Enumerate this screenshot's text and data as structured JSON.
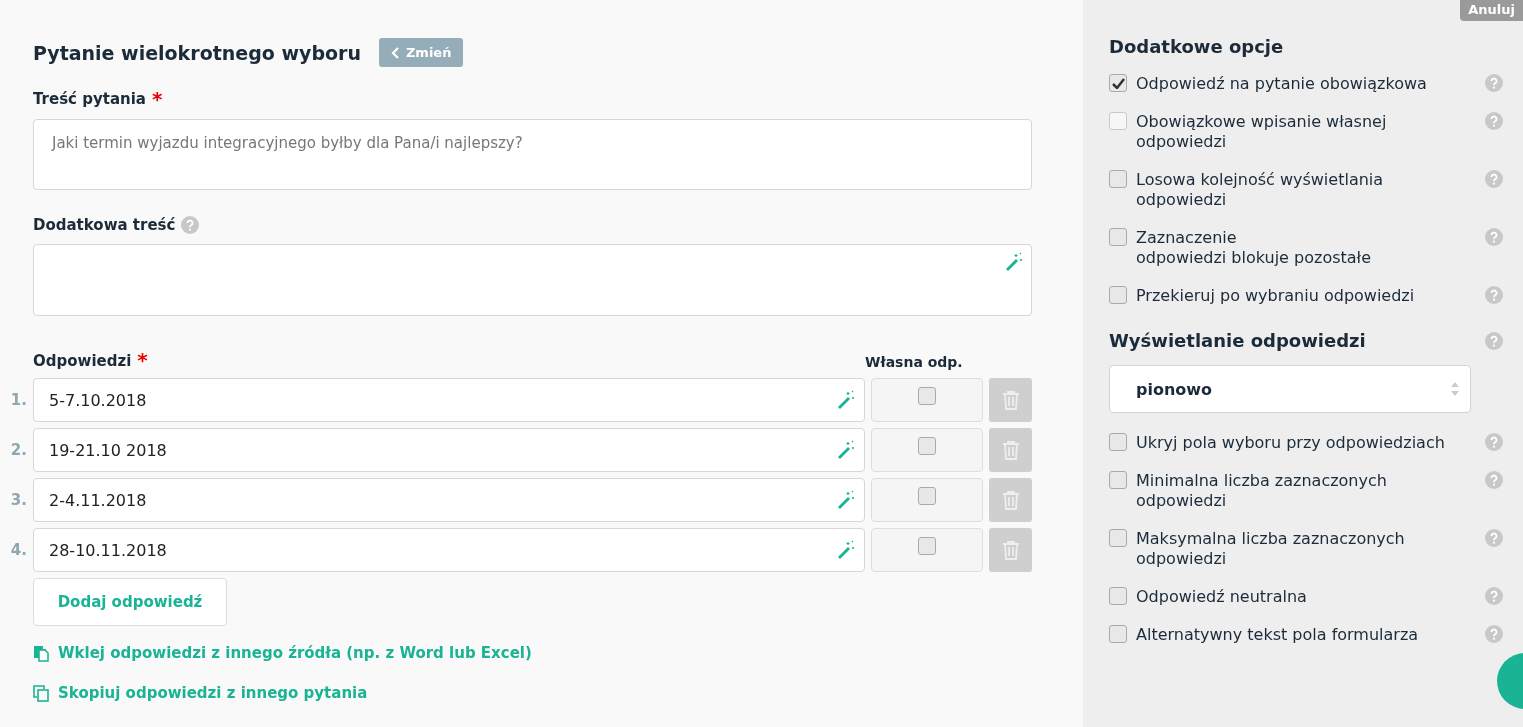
{
  "header": {
    "title": "Pytanie wielokrotnego wyboru",
    "change_button": "Zmień"
  },
  "question": {
    "label": "Treść pytania",
    "required_mark": "*",
    "placeholder": "Jaki termin wyjazdu integracyjnego byłby dla Pana/i najlepszy?"
  },
  "extra": {
    "label": "Dodatkowa treść"
  },
  "answers": {
    "label": "Odpowiedzi",
    "required_mark": "*",
    "own_label": "Własna odp.",
    "items": [
      {
        "number": "1.",
        "value": "5-7.10.2018",
        "own": false
      },
      {
        "number": "2.",
        "value": "19-21.10 2018",
        "own": false
      },
      {
        "number": "3.",
        "value": "2-4.11.2018",
        "own": false
      },
      {
        "number": "4.",
        "value": "28-10.11.2018",
        "own": false
      }
    ],
    "add_button": "Dodaj odpowiedź",
    "links": [
      {
        "kind": "paste",
        "text": "Wklej odpowiedzi z innego źródła (np. z Word lub Excel)"
      },
      {
        "kind": "copy",
        "text": "Skopiuj odpowiedzi z innego pytania"
      }
    ]
  },
  "sidebar": {
    "cancel_button": "Anuluj",
    "options_title": "Dodatkowe opcje",
    "options": [
      {
        "label": "Odpowiedź na pytanie obowiązkowa",
        "checked": true,
        "disabled": false
      },
      {
        "label": "Obowiązkowe wpisanie własnej odpowiedzi",
        "checked": false,
        "disabled": true
      },
      {
        "label": "Losowa kolejność wyświetlania odpowiedzi",
        "checked": false,
        "disabled": false
      },
      {
        "label": "Zaznaczenie\nodpowiedzi blokuje pozostałe",
        "checked": false,
        "disabled": false
      },
      {
        "label": "Przekieruj po wybraniu odpowiedzi",
        "checked": false,
        "disabled": false
      }
    ],
    "display_title": "Wyświetlanie odpowiedzi",
    "display_value": "pionowo",
    "display_options": [
      {
        "label": "Ukryj pola wyboru przy odpowiedziach",
        "checked": false,
        "disabled": false
      },
      {
        "label": "Minimalna liczba zaznaczonych odpowiedzi",
        "checked": false,
        "disabled": false
      },
      {
        "label": "Maksymalna liczba zaznaczonych odpowiedzi",
        "checked": false,
        "disabled": false
      },
      {
        "label": "Odpowiedź neutralna",
        "checked": false,
        "disabled": false
      },
      {
        "label": "Alternatywny tekst pola formularza",
        "checked": false,
        "disabled": false
      }
    ]
  }
}
